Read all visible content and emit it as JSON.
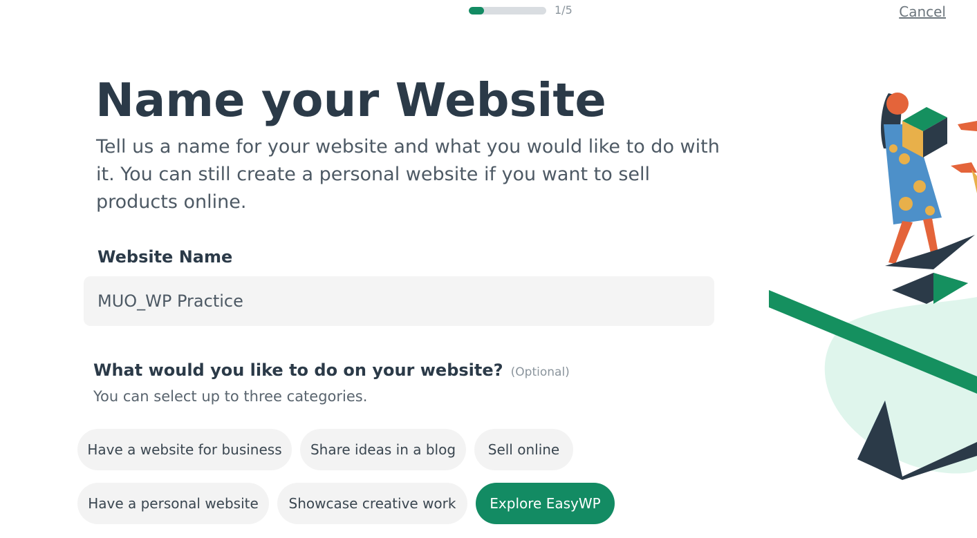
{
  "progress": {
    "step_text": "1/5",
    "fraction": 0.2
  },
  "header": {
    "cancel_label": "Cancel"
  },
  "main": {
    "title": "Name your Website",
    "subtitle": "Tell us a name for your website and what you would like to do with it. You can still create a personal website if you want to sell products online.",
    "website_name_label": "Website Name",
    "website_name_value": "MUO_WP Practice",
    "question": "What would you like to do on your website?",
    "question_optional": "(Optional)",
    "question_hint": "You can select up to three categories.",
    "chips": [
      {
        "label": "Have a website for business"
      },
      {
        "label": "Share ideas in a blog"
      },
      {
        "label": "Sell online"
      },
      {
        "label": "Have a personal website"
      },
      {
        "label": "Showcase creative work"
      },
      {
        "label": "Explore EasyWP"
      }
    ]
  },
  "colors": {
    "accent": "#138b63",
    "text_dark": "#2b3a48",
    "chip_bg": "#f3f3f3"
  },
  "illustration": {
    "icon": "woman-with-box-illustration"
  }
}
